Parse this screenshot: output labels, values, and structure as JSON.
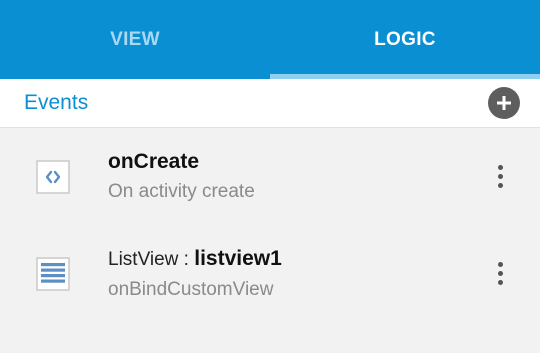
{
  "tabs": [
    {
      "label": "VIEW",
      "active": false
    },
    {
      "label": "LOGIC",
      "active": true
    }
  ],
  "events_bar": {
    "title": "Events",
    "add_icon": "plus-circle-icon"
  },
  "events": [
    {
      "icon": "code-brackets-icon",
      "title_prefix": "",
      "title": "onCreate",
      "subtitle": "On activity create"
    },
    {
      "icon": "listview-icon",
      "title_prefix": "ListView : ",
      "title": "listview1",
      "subtitle": "onBindCustomView"
    }
  ],
  "colors": {
    "primary": "#0a8fd2",
    "tab_inactive": "#a9d8f2",
    "tab_indicator": "#8fd0f1",
    "icon_blue": "#5d8fc4"
  }
}
